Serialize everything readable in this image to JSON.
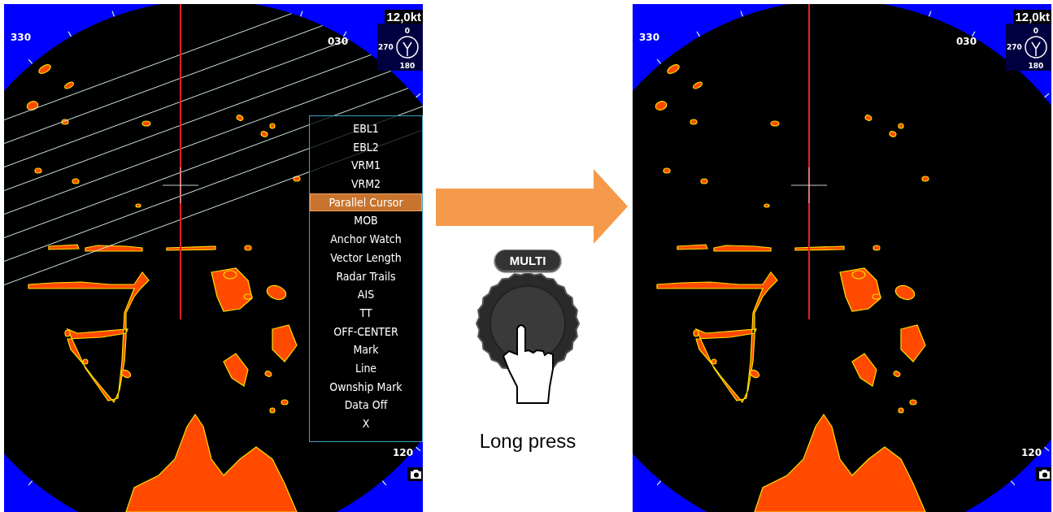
{
  "panels": [
    {
      "range_labels": [
        "330",
        "030",
        "120"
      ],
      "speed": "12,0kt",
      "compass_labels": [
        "0",
        "270",
        "180"
      ],
      "parallel_cursor_shown": true,
      "menu": {
        "items": [
          {
            "label": "EBL1",
            "selected": false
          },
          {
            "label": "EBL2",
            "selected": false
          },
          {
            "label": "VRM1",
            "selected": false
          },
          {
            "label": "VRM2",
            "selected": false
          },
          {
            "label": "Parallel Cursor",
            "selected": true
          },
          {
            "label": "MOB",
            "selected": false
          },
          {
            "label": "Anchor Watch",
            "selected": false
          },
          {
            "label": "Vector Length",
            "selected": false
          },
          {
            "label": "Radar Trails",
            "selected": false
          },
          {
            "label": "AIS",
            "selected": false
          },
          {
            "label": "TT",
            "selected": false
          },
          {
            "label": "OFF-CENTER",
            "selected": false
          },
          {
            "label": "Mark",
            "selected": false
          },
          {
            "label": "Line",
            "selected": false
          },
          {
            "label": "Ownship Mark",
            "selected": false
          },
          {
            "label": "Data Off",
            "selected": false
          },
          {
            "label": "X",
            "selected": false
          }
        ]
      }
    },
    {
      "range_labels": [
        "330",
        "030",
        "120"
      ],
      "speed": "12,0kt",
      "compass_labels": [
        "0",
        "270",
        "180"
      ],
      "parallel_cursor_shown": false
    }
  ],
  "action": {
    "button_label": "MULTI",
    "caption": "Long press"
  }
}
